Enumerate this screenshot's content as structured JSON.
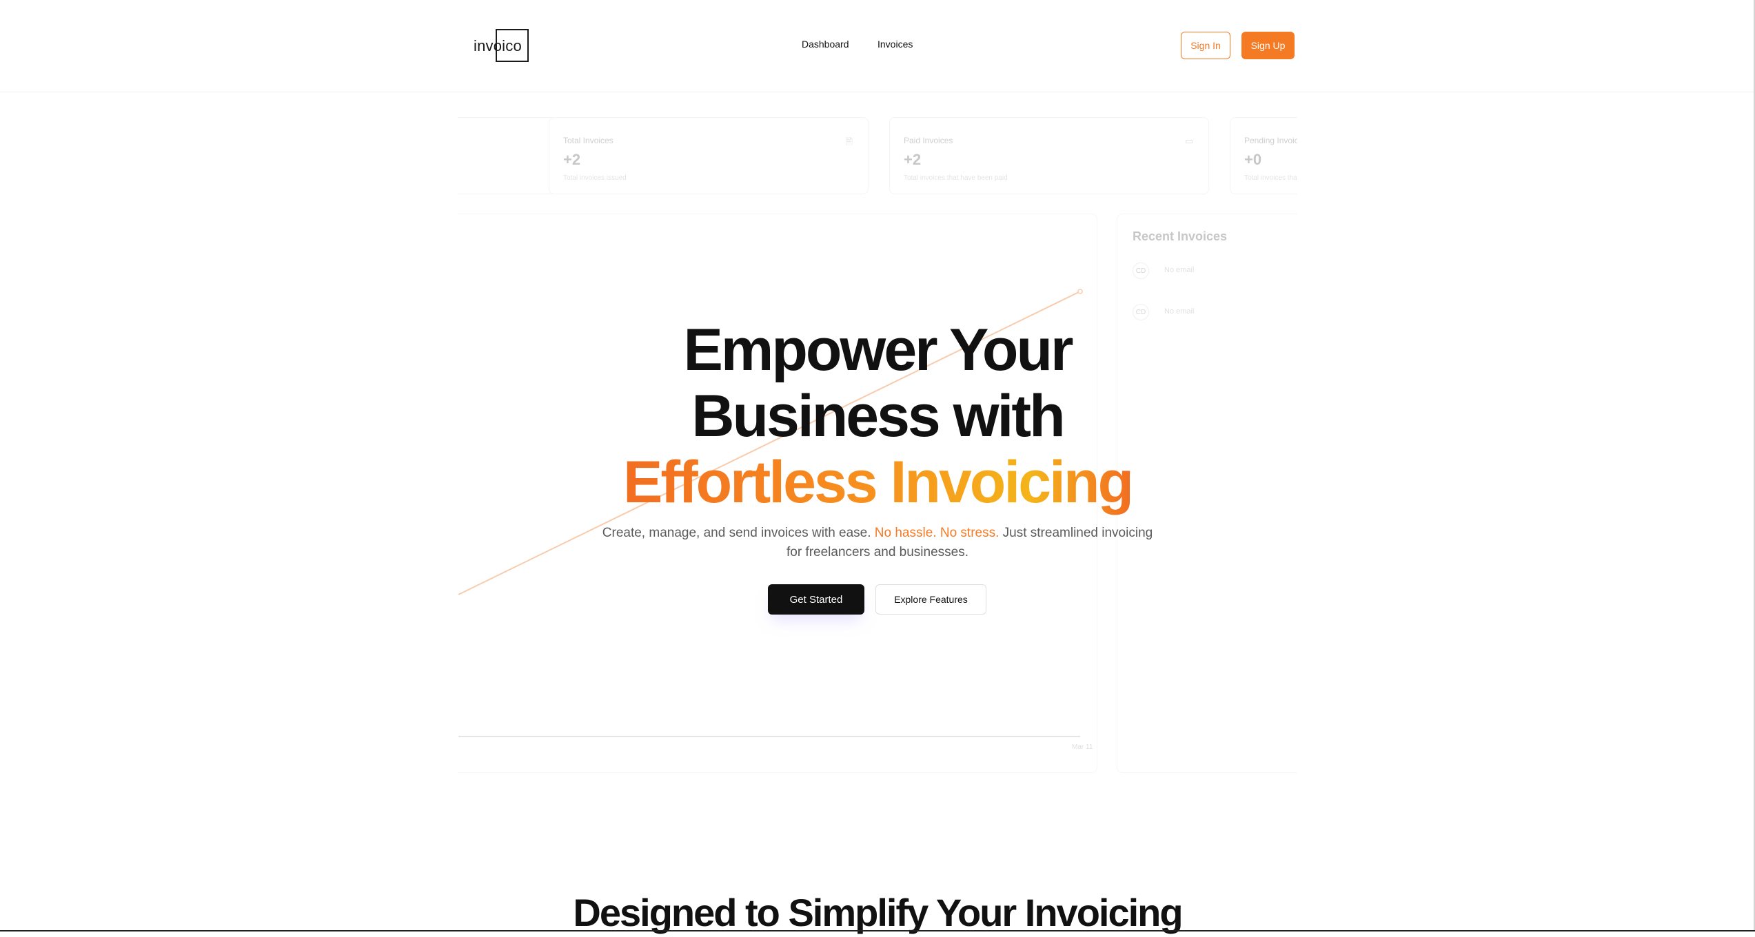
{
  "header": {
    "logo_text": "invoico",
    "nav": [
      {
        "label": "Dashboard"
      },
      {
        "label": "Invoices"
      }
    ],
    "sign_in": "Sign In",
    "sign_up": "Sign Up"
  },
  "dashboard_bg": {
    "cards": [
      {
        "label": "",
        "value": "",
        "sub": "",
        "icon": "dollar-icon",
        "icon_glyph": "$"
      },
      {
        "label": "Total Invoices",
        "value": "+2",
        "sub": "Total invoices issued",
        "icon": "file-icon",
        "icon_glyph": "🗎"
      },
      {
        "label": "Paid Invoices",
        "value": "+2",
        "sub": "Total invoices that have been paid",
        "icon": "credit-card-icon",
        "icon_glyph": "▭"
      },
      {
        "label": "Pending Invoice",
        "value": "+0",
        "sub": "Total invoices tha",
        "icon": "",
        "icon_glyph": ""
      }
    ],
    "chart": {
      "x_tick": "Mar 11"
    },
    "recent": {
      "title": "Recent Invoices",
      "items": [
        {
          "initials": "CD",
          "email": "No email"
        },
        {
          "initials": "CD",
          "email": "No email"
        }
      ]
    }
  },
  "hero": {
    "line1": "Empower Your",
    "line2": "Business with",
    "line3": "Effortless Invoicing",
    "sub_part1": "Create, manage, and send invoices with ease.",
    "sub_accent": "No hassle. No stress.",
    "sub_part2": "Just streamlined invoicing for freelancers and businesses.",
    "cta_primary": "Get Started",
    "cta_secondary": "Explore Features"
  },
  "features": {
    "heading": "Designed to Simplify Your Invoicing"
  },
  "colors": {
    "accent": "#f47a24",
    "dark": "#111111"
  }
}
